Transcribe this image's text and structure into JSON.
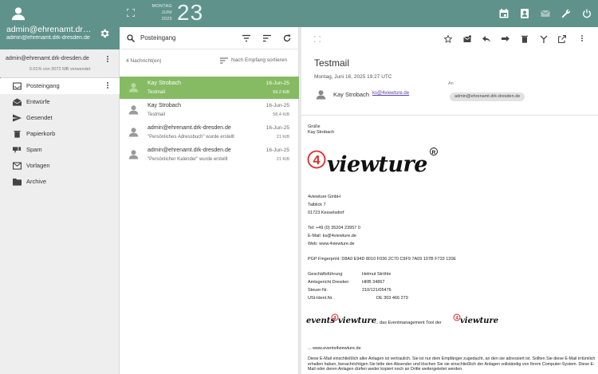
{
  "account": {
    "name": "admin@ehrenamt.drk-dresden.de",
    "email": "admin@ehrenamt.drk-dresden.de",
    "row_label": "admin@ehrenamt.drk-dresden.de",
    "quota": "0.01% von 3072 MB verwendet",
    "quota_fraction": 0.0001
  },
  "folders": [
    {
      "label": "Posteingang",
      "icon": "inbox-icon",
      "active": true
    },
    {
      "label": "Entwürfe",
      "icon": "drafts-icon",
      "active": false
    },
    {
      "label": "Gesendet",
      "icon": "sent-icon",
      "active": false
    },
    {
      "label": "Papierkorb",
      "icon": "trash-icon",
      "active": false
    },
    {
      "label": "Spam",
      "icon": "spam-icon",
      "active": false
    },
    {
      "label": "Vorlagen",
      "icon": "templates-icon",
      "active": false
    },
    {
      "label": "Archive",
      "icon": "archive-folder-icon",
      "active": false
    }
  ],
  "topbar": {
    "weekday": "MONTAG",
    "month": "JUNI",
    "year": "2025",
    "day": "23",
    "icons": [
      "calendar-icon",
      "contacts-icon",
      "mail-icon",
      "tools-icon",
      "power-icon"
    ]
  },
  "list": {
    "folder_title": "Posteingang",
    "count": "4 Nachricht(en)",
    "sort_label": "Nach Empfang sortieren",
    "messages": [
      {
        "from": "Kay Strobach",
        "date": "16-Jun-25",
        "subject": "Testmail",
        "size": "59.2 KiB",
        "selected": true
      },
      {
        "from": "Kay Strobach",
        "date": "16-Jun-25",
        "subject": "Testmail",
        "size": "58.4 KiB",
        "selected": false
      },
      {
        "from": "admin@ehrenamt.drk-dresden.de",
        "date": "16-Jun-25",
        "subject": "\"Persönliches Adressbuch\" wurde erstellt",
        "size": "21 KiB",
        "selected": false
      },
      {
        "from": "admin@ehrenamt.drk-dresden.de",
        "date": "16-Jun-25",
        "subject": "\"Persönlicher Kalender\" wurde erstellt",
        "size": "21 KiB",
        "selected": false
      }
    ]
  },
  "reader": {
    "subject": "Testmail",
    "date": "Montag, Juni 16, 2025 19:27 UTC",
    "sender_name": "Kay Strobach",
    "sender_email": "ks@4viewture.de",
    "to_label": "An",
    "to_chip": "admin@ehrenamt.drk-dresden.de",
    "body": {
      "greeting": "Grüße",
      "signature_name": "Kay Strobach",
      "logo_text": "viewture",
      "logo_number": "4",
      "logo_mark": "R",
      "company": "4viewture GmbH",
      "street": "Talblick 7",
      "city": "01723 Kesselsdorf",
      "tel": "Tel: +49 (0) 35204 23957 0",
      "email": "E-Mail: ks@4viewture.de",
      "web": "Web: www.4viewture.de",
      "pgp": "PGP Fingerprint: D8A0 E94D 8010 F036 2C70  C9F9 7A09 107B F733 120E",
      "gf_label": "Geschäftsführung",
      "gf_value": "Helmut Ströhle",
      "ag_label": "Amtsgericht Dresden",
      "ag_value": "HRB 34867",
      "st_label": "Steuer-Nr.",
      "st_value": "210/121/05476",
      "ust_label": "USt-Ident.Nr.",
      "ust_value": "DE 303 466 279",
      "events_word": "events",
      "events_number": "4",
      "events_brand": "viewture",
      "events_middle": "... das Eventmanagement Tool der",
      "events_link": "... www.events4viewture.de",
      "disclaimer": "Diese E-Mail einschließlich aller Anlagen ist vertraulich. Sie ist nur dem Empfänger zugedacht, an den sie adressiert ist. Sollten Sie diese E-Mail irrtümlich erhalten haben, benachrichtigen Sie bitte den Absender und löschen Sie sie einschließlich der Anlagen vollständig von Ihrem Computer-System. Diese E-Mail oder deren Anlagen dürfen weder kopiert noch an Dritte weitergeleitet werden."
    }
  },
  "colors": {
    "header": "#5f928b",
    "selected_row": "#86bb63",
    "brand_red": "#d92b2b"
  }
}
